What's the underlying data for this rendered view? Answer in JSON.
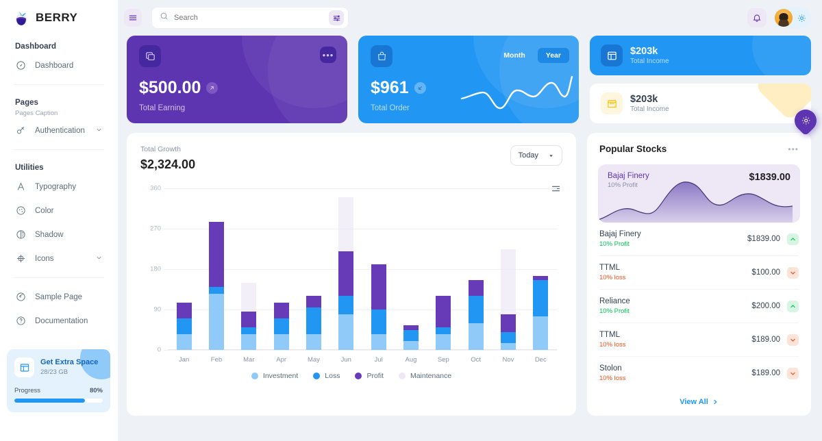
{
  "brand": {
    "name": "BERRY"
  },
  "topbar": {
    "search_placeholder": "Search",
    "search_value": "",
    "menu_icon": "hamburger-icon",
    "filter_icon": "filter-sliders-icon",
    "bell_icon": "bell-icon",
    "gear_icon": "gear-icon"
  },
  "sidebar": {
    "sections": [
      {
        "title": "Dashboard",
        "caption": "",
        "items": [
          {
            "label": "Dashboard",
            "icon": "speedometer-icon",
            "chevron": false
          }
        ]
      },
      {
        "title": "Pages",
        "caption": "Pages Caption",
        "items": [
          {
            "label": "Authentication",
            "icon": "key-icon",
            "chevron": true
          }
        ]
      },
      {
        "title": "Utilities",
        "caption": "",
        "items": [
          {
            "label": "Typography",
            "icon": "typography-icon",
            "chevron": false
          },
          {
            "label": "Color",
            "icon": "palette-icon",
            "chevron": false
          },
          {
            "label": "Shadow",
            "icon": "shadow-icon",
            "chevron": false
          },
          {
            "label": "Icons",
            "icon": "icons-grid-icon",
            "chevron": true
          }
        ]
      },
      {
        "title": "",
        "caption": "",
        "items": [
          {
            "label": "Sample Page",
            "icon": "chrome-icon",
            "chevron": false
          },
          {
            "label": "Documentation",
            "icon": "question-circle-icon",
            "chevron": false
          }
        ]
      }
    ],
    "extra_space": {
      "title": "Get Extra Space",
      "subtitle": "28/23 GB",
      "progress_label": "Progress",
      "progress_value": "80%",
      "progress_percent": 80,
      "icon": "storage-icon"
    }
  },
  "cards": {
    "total_earning": {
      "value": "$500.00",
      "label": "Total Earning",
      "icon": "copy-icon",
      "badge_icon": "arrow-up-icon",
      "menu_label": "•••",
      "color": "#5e35b1"
    },
    "total_order": {
      "value": "$961",
      "label": "Total Order",
      "icon": "bag-icon",
      "badge_icon": "arrow-down-icon",
      "toggle": {
        "month": "Month",
        "year": "Year",
        "active": "Year"
      },
      "color": "#2196f3"
    },
    "income_blue": {
      "value": "$203k",
      "label": "Total Income",
      "icon": "table-icon",
      "color": "#2196f3"
    },
    "income_white": {
      "value": "$203k",
      "label": "Total Income",
      "icon": "store-icon",
      "color": "#ffc107"
    }
  },
  "growth": {
    "subtitle": "Total Growth",
    "value": "$2,324.00",
    "period_select": "Today",
    "menu_icon": "hamburger-menu-icon"
  },
  "chart_data": {
    "type": "bar",
    "title": "Total Growth",
    "stacked": true,
    "categories": [
      "Jan",
      "Feb",
      "Mar",
      "Apr",
      "May",
      "Jun",
      "Jul",
      "Aug",
      "Sep",
      "Oct",
      "Nov",
      "Dec"
    ],
    "series": [
      {
        "name": "Investment",
        "color": "#90caf9",
        "values": [
          35,
          125,
          35,
          35,
          35,
          80,
          35,
          20,
          35,
          60,
          15,
          75
        ]
      },
      {
        "name": "Loss",
        "color": "#2196f3",
        "values": [
          35,
          15,
          15,
          35,
          60,
          40,
          55,
          25,
          15,
          60,
          25,
          80
        ]
      },
      {
        "name": "Profit",
        "color": "#673ab7",
        "values": [
          35,
          145,
          35,
          35,
          25,
          100,
          100,
          10,
          70,
          35,
          40,
          10
        ]
      },
      {
        "name": "Maintenance",
        "color": "#ede7f6",
        "values": [
          0,
          0,
          150,
          0,
          0,
          340,
          0,
          0,
          0,
          0,
          225,
          0
        ]
      }
    ],
    "ylabel": "",
    "xlabel": "",
    "ylim": [
      0,
      360
    ],
    "yticks": [
      0,
      90,
      180,
      270,
      360
    ],
    "grid": true,
    "legend_position": "bottom"
  },
  "stocks": {
    "title": "Popular Stocks",
    "menu_label": "•••",
    "featured": {
      "name": "Bajaj Finery",
      "subtitle": "10% Profit",
      "value": "$1839.00",
      "chart_type": "area",
      "color": "#7e6bb5"
    },
    "rows": [
      {
        "name": "Bajaj Finery",
        "subtitle": "10% Profit",
        "value": "$1839.00",
        "direction": "up"
      },
      {
        "name": "TTML",
        "subtitle": "10% loss",
        "value": "$100.00",
        "direction": "down"
      },
      {
        "name": "Reliance",
        "subtitle": "10% Profit",
        "value": "$200.00",
        "direction": "up"
      },
      {
        "name": "TTML",
        "subtitle": "10% loss",
        "value": "$189.00",
        "direction": "down"
      },
      {
        "name": "Stolon",
        "subtitle": "10% loss",
        "value": "$189.00",
        "direction": "down"
      }
    ],
    "view_all": "View All"
  },
  "fab": {
    "icon": "gear-icon"
  }
}
